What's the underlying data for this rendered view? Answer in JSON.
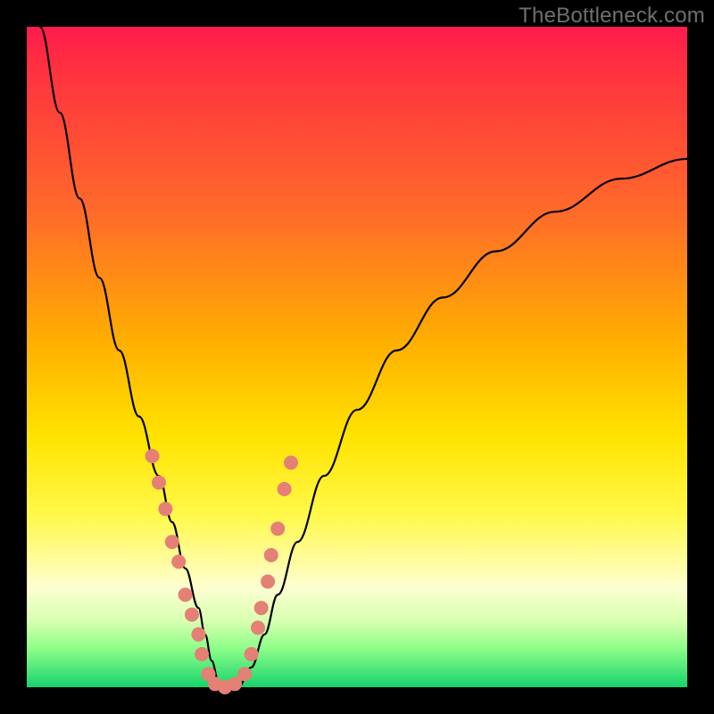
{
  "watermark": "TheBottleneck.com",
  "colors": {
    "frame": "#000000",
    "gradient_top": "#ff1a4d",
    "gradient_bottom": "#17d36b",
    "curve": "#000000",
    "dots": "#e48076"
  },
  "chart_data": {
    "type": "line",
    "title": "",
    "xlabel": "",
    "ylabel": "",
    "xlim": [
      0,
      100
    ],
    "ylim": [
      0,
      100
    ],
    "note": "Axes have no visible tick labels; values are estimated as percentages of the plot area (0 = left/bottom, 100 = right/top).",
    "series": [
      {
        "name": "bottleneck-curve",
        "x": [
          2,
          5,
          8,
          11,
          14,
          17,
          20,
          22,
          24,
          26,
          27,
          28,
          29,
          30,
          32,
          34,
          36,
          38,
          41,
          45,
          50,
          56,
          63,
          71,
          80,
          90,
          100
        ],
        "y": [
          100,
          87,
          74,
          62,
          51,
          41,
          32,
          25,
          18,
          12,
          8,
          4,
          1,
          0,
          0,
          3,
          8,
          14,
          22,
          32,
          42,
          51,
          59,
          66,
          72,
          77,
          80
        ]
      }
    ],
    "markers": [
      {
        "x": 19,
        "y": 35
      },
      {
        "x": 20,
        "y": 31
      },
      {
        "x": 21,
        "y": 27
      },
      {
        "x": 22,
        "y": 22
      },
      {
        "x": 23,
        "y": 19
      },
      {
        "x": 24,
        "y": 14
      },
      {
        "x": 25,
        "y": 11
      },
      {
        "x": 26,
        "y": 8
      },
      {
        "x": 26.5,
        "y": 5
      },
      {
        "x": 27.5,
        "y": 2
      },
      {
        "x": 28.5,
        "y": 0.5
      },
      {
        "x": 30,
        "y": 0
      },
      {
        "x": 31.5,
        "y": 0.5
      },
      {
        "x": 33,
        "y": 2
      },
      {
        "x": 34,
        "y": 5
      },
      {
        "x": 35,
        "y": 9
      },
      {
        "x": 35.5,
        "y": 12
      },
      {
        "x": 36.5,
        "y": 16
      },
      {
        "x": 37,
        "y": 20
      },
      {
        "x": 38,
        "y": 24
      },
      {
        "x": 39,
        "y": 30
      },
      {
        "x": 40,
        "y": 34
      }
    ]
  }
}
